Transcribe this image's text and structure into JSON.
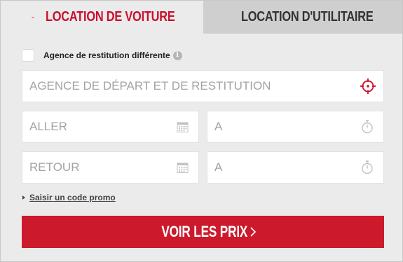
{
  "tabs": {
    "car": {
      "label": "LOCATION DE VOITURE",
      "icon": "car-icon",
      "color": "#c8102e"
    },
    "van": {
      "label": "LOCATION D'UTILITAIRE",
      "icon": "van-icon",
      "color": "#333333"
    }
  },
  "form": {
    "different_return": {
      "label": "Agence de restitution différente",
      "checked": false,
      "info_icon": "info-icon"
    },
    "agency": {
      "placeholder": "AGENCE DE DÉPART ET DE RESTITUTION",
      "icon": "crosshair-icon"
    },
    "outbound_date": {
      "placeholder": "ALLER",
      "icon": "calendar-icon"
    },
    "outbound_time": {
      "placeholder": "A",
      "icon": "stopwatch-icon"
    },
    "return_date": {
      "placeholder": "RETOUR",
      "icon": "calendar-icon"
    },
    "return_time": {
      "placeholder": "A",
      "icon": "stopwatch-icon"
    },
    "promo_link": "Saisir un code promo",
    "submit": {
      "label": "VOIR LES PRIX",
      "icon": "chevron-right-icon",
      "color": "#cc1a2c"
    }
  }
}
